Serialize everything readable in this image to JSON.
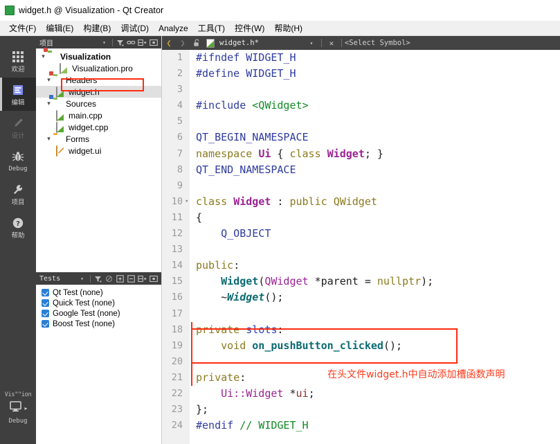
{
  "window": {
    "title": "widget.h @ Visualization - Qt Creator",
    "app_icon": "qt-creator-icon"
  },
  "menubar": {
    "items": [
      {
        "label": "文件(F)",
        "mnemonic": "F"
      },
      {
        "label": "编辑(E)",
        "mnemonic": "E"
      },
      {
        "label": "构建(B)",
        "mnemonic": "B"
      },
      {
        "label": "调试(D)",
        "mnemonic": "D"
      },
      {
        "label": "Analyze",
        "mnemonic": "A"
      },
      {
        "label": "工具(T)",
        "mnemonic": "T"
      },
      {
        "label": "控件(W)",
        "mnemonic": "W"
      },
      {
        "label": "帮助(H)",
        "mnemonic": "H"
      }
    ]
  },
  "modebar": {
    "items": [
      {
        "label": "欢迎",
        "icon": "grid-icon",
        "state": "normal"
      },
      {
        "label": "编辑",
        "icon": "document-lines-icon",
        "state": "selected"
      },
      {
        "label": "设计",
        "icon": "pencil-icon",
        "state": "disabled"
      },
      {
        "label": "Debug",
        "icon": "bug-icon",
        "state": "normal"
      },
      {
        "label": "项目",
        "icon": "wrench-icon",
        "state": "normal"
      },
      {
        "label": "帮助",
        "icon": "question-mark-icon",
        "state": "normal"
      }
    ],
    "kit": {
      "project_label": "Vis\"\"ion",
      "run_icon": "monitor-icon",
      "run_label": "Debug"
    }
  },
  "project_panel": {
    "header_title": "项目",
    "toolbar_icons": [
      "chevron-down-icon",
      "filter-icon",
      "link-sync-icon",
      "split-add-icon",
      "dock-icon"
    ],
    "nav_icons": [
      "chevron-left-icon",
      "chevron-right-icon"
    ],
    "tree": [
      {
        "label": "Visualization",
        "icon": "project-folder-icon",
        "indent": 0,
        "twisty": "open",
        "bold": true,
        "selected": false
      },
      {
        "label": "Visualization.pro",
        "icon": "pro-file-icon",
        "indent": 1,
        "twisty": "none",
        "bold": false,
        "selected": false
      },
      {
        "label": "Headers",
        "icon": "headers-folder-icon",
        "indent": 1,
        "twisty": "open",
        "bold": false,
        "selected": false
      },
      {
        "label": "widget.h",
        "icon": "header-file-icon",
        "indent": 2,
        "twisty": "none",
        "bold": false,
        "selected": true
      },
      {
        "label": "Sources",
        "icon": "sources-folder-icon",
        "indent": 1,
        "twisty": "open",
        "bold": false,
        "selected": false
      },
      {
        "label": "main.cpp",
        "icon": "cpp-file-icon",
        "indent": 2,
        "twisty": "none",
        "bold": false,
        "selected": false
      },
      {
        "label": "widget.cpp",
        "icon": "cpp-file-icon",
        "indent": 2,
        "twisty": "none",
        "bold": false,
        "selected": false
      },
      {
        "label": "Forms",
        "icon": "forms-folder-icon",
        "indent": 1,
        "twisty": "open",
        "bold": false,
        "selected": false
      },
      {
        "label": "widget.ui",
        "icon": "ui-file-icon",
        "indent": 2,
        "twisty": "none",
        "bold": false,
        "selected": false
      }
    ]
  },
  "tests_panel": {
    "header_title": "Tests",
    "toolbar_icons": [
      "chevron-down-icon",
      "filter-icon",
      "no-scan-icon",
      "expand-all-icon",
      "collapse-all-icon",
      "split-add-icon",
      "dock-icon"
    ],
    "rows": [
      {
        "label": "Qt Test (none)",
        "checked": true
      },
      {
        "label": "Quick Test (none)",
        "checked": true
      },
      {
        "label": "Google Test (none)",
        "checked": true
      },
      {
        "label": "Boost Test (none)",
        "checked": true
      }
    ]
  },
  "editor": {
    "tab": {
      "lock_icon": "unlocked-icon",
      "file_icon": "header-file-icon",
      "filename": "widget.h*",
      "dropdown_icon": "chevron-down-icon",
      "close_icon": "close-icon",
      "symbol_selector": "<Select Symbol>"
    },
    "lines": [
      {
        "n": "1",
        "fold": false,
        "changed": false,
        "tokens": [
          {
            "t": "#ifndef ",
            "c": "c-pre"
          },
          {
            "t": "WIDGET_H",
            "c": "c-pre"
          }
        ]
      },
      {
        "n": "2",
        "fold": false,
        "changed": false,
        "tokens": [
          {
            "t": "#define ",
            "c": "c-pre"
          },
          {
            "t": "WIDGET_H",
            "c": "c-pre"
          }
        ]
      },
      {
        "n": "3",
        "fold": false,
        "changed": false,
        "tokens": []
      },
      {
        "n": "4",
        "fold": false,
        "changed": false,
        "tokens": [
          {
            "t": "#include ",
            "c": "c-pre"
          },
          {
            "t": "<QWidget>",
            "c": "c-str"
          }
        ]
      },
      {
        "n": "5",
        "fold": false,
        "changed": false,
        "tokens": []
      },
      {
        "n": "6",
        "fold": false,
        "changed": false,
        "tokens": [
          {
            "t": "QT_BEGIN_NAMESPACE",
            "c": "c-macro"
          }
        ]
      },
      {
        "n": "7",
        "fold": false,
        "changed": false,
        "tokens": [
          {
            "t": "namespace ",
            "c": "c-key"
          },
          {
            "t": "Ui",
            "c": "c-type"
          },
          {
            "t": " { ",
            "c": "c-plain"
          },
          {
            "t": "class ",
            "c": "c-key"
          },
          {
            "t": "Widget",
            "c": "c-type"
          },
          {
            "t": "; }",
            "c": "c-plain"
          }
        ]
      },
      {
        "n": "8",
        "fold": false,
        "changed": false,
        "tokens": [
          {
            "t": "QT_END_NAMESPACE",
            "c": "c-macro"
          }
        ]
      },
      {
        "n": "9",
        "fold": false,
        "changed": false,
        "tokens": []
      },
      {
        "n": "10",
        "fold": true,
        "changed": false,
        "tokens": [
          {
            "t": "class ",
            "c": "c-key"
          },
          {
            "t": "Widget",
            "c": "c-type"
          },
          {
            "t": " : ",
            "c": "c-plain"
          },
          {
            "t": "public ",
            "c": "c-key"
          },
          {
            "t": "QWidget",
            "c": "c-olive"
          }
        ]
      },
      {
        "n": "11",
        "fold": false,
        "changed": false,
        "tokens": [
          {
            "t": "{",
            "c": "c-plain"
          }
        ]
      },
      {
        "n": "12",
        "fold": false,
        "changed": false,
        "tokens": [
          {
            "t": "    Q_OBJECT",
            "c": "c-macro"
          }
        ]
      },
      {
        "n": "13",
        "fold": false,
        "changed": false,
        "tokens": []
      },
      {
        "n": "14",
        "fold": false,
        "changed": false,
        "tokens": [
          {
            "t": "public",
            "c": "c-key"
          },
          {
            "t": ":",
            "c": "c-plain"
          }
        ]
      },
      {
        "n": "15",
        "fold": false,
        "changed": false,
        "tokens": [
          {
            "t": "    ",
            "c": "c-plain"
          },
          {
            "t": "Widget",
            "c": "c-func"
          },
          {
            "t": "(",
            "c": "c-plain"
          },
          {
            "t": "QWidget",
            "c": "c-typep"
          },
          {
            "t": " *parent = ",
            "c": "c-plain"
          },
          {
            "t": "nullptr",
            "c": "c-olive"
          },
          {
            "t": ");",
            "c": "c-plain"
          }
        ]
      },
      {
        "n": "16",
        "fold": false,
        "changed": false,
        "tokens": [
          {
            "t": "    ~",
            "c": "c-plain"
          },
          {
            "t": "Widget",
            "c": "c-func-i"
          },
          {
            "t": "();",
            "c": "c-plain"
          }
        ]
      },
      {
        "n": "17",
        "fold": false,
        "changed": false,
        "tokens": []
      },
      {
        "n": "18",
        "fold": false,
        "changed": true,
        "tokens": [
          {
            "t": "private ",
            "c": "c-key"
          },
          {
            "t": "slots",
            "c": "c-key2"
          },
          {
            "t": ":",
            "c": "c-plain"
          }
        ]
      },
      {
        "n": "19",
        "fold": false,
        "changed": true,
        "tokens": [
          {
            "t": "    ",
            "c": "c-plain"
          },
          {
            "t": "void ",
            "c": "c-key"
          },
          {
            "t": "on_pushButton_clicked",
            "c": "c-func"
          },
          {
            "t": "();",
            "c": "c-plain"
          }
        ]
      },
      {
        "n": "20",
        "fold": false,
        "changed": true,
        "tokens": []
      },
      {
        "n": "21",
        "fold": false,
        "changed": true,
        "tokens": [
          {
            "t": "private",
            "c": "c-key"
          },
          {
            "t": ":",
            "c": "c-plain"
          }
        ]
      },
      {
        "n": "22",
        "fold": false,
        "changed": false,
        "tokens": [
          {
            "t": "    ",
            "c": "c-plain"
          },
          {
            "t": "Ui::Widget",
            "c": "c-typep"
          },
          {
            "t": " *",
            "c": "c-plain"
          },
          {
            "t": "ui",
            "c": "c-field"
          },
          {
            "t": ";",
            "c": "c-plain"
          }
        ]
      },
      {
        "n": "23",
        "fold": false,
        "changed": false,
        "tokens": [
          {
            "t": "};",
            "c": "c-plain"
          }
        ]
      },
      {
        "n": "24",
        "fold": false,
        "changed": false,
        "tokens": [
          {
            "t": "#endif ",
            "c": "c-pre"
          },
          {
            "t": "// WIDGET_H",
            "c": "c-cmt"
          }
        ]
      }
    ]
  },
  "annotations": {
    "note_text": "在头文件widget.h中自动添加槽函数声明",
    "color": "#ff3b1d",
    "boxes": [
      {
        "name": "tree-widget-h-highlight"
      },
      {
        "name": "slot-declaration-highlight"
      }
    ]
  }
}
